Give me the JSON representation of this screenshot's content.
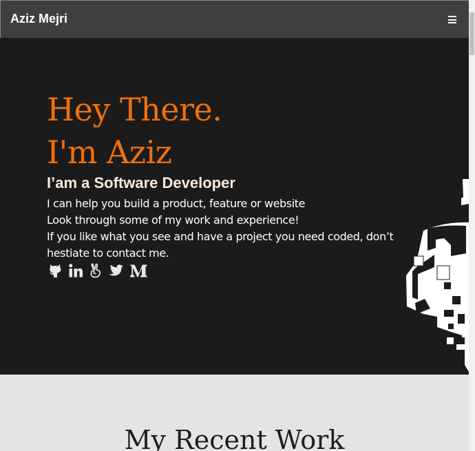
{
  "navbar": {
    "brand": "Aziz Mejri",
    "menu_icon": "hamburger-icon"
  },
  "hero": {
    "title_line1": "Hey There.",
    "title_line2": "I'm Aziz",
    "subtitle": "I’am a Software Developer",
    "lines": [
      "I can help you build a product, feature or website",
      "Look through some of my work and experience!",
      "If you like what you see and have a project you need coded, don’t hestiate to contact me."
    ],
    "socials": [
      "github-icon",
      "linkedin-icon",
      "angellist-icon",
      "twitter-icon",
      "medium-icon"
    ]
  },
  "work": {
    "title": "My Recent Work"
  },
  "colors": {
    "accent": "#f0700a",
    "hero_bg": "#1c1b1b",
    "navbar_bg": "#3f3f3f",
    "subtitle": "#fbeada",
    "section_bg": "#e4e4e4"
  }
}
